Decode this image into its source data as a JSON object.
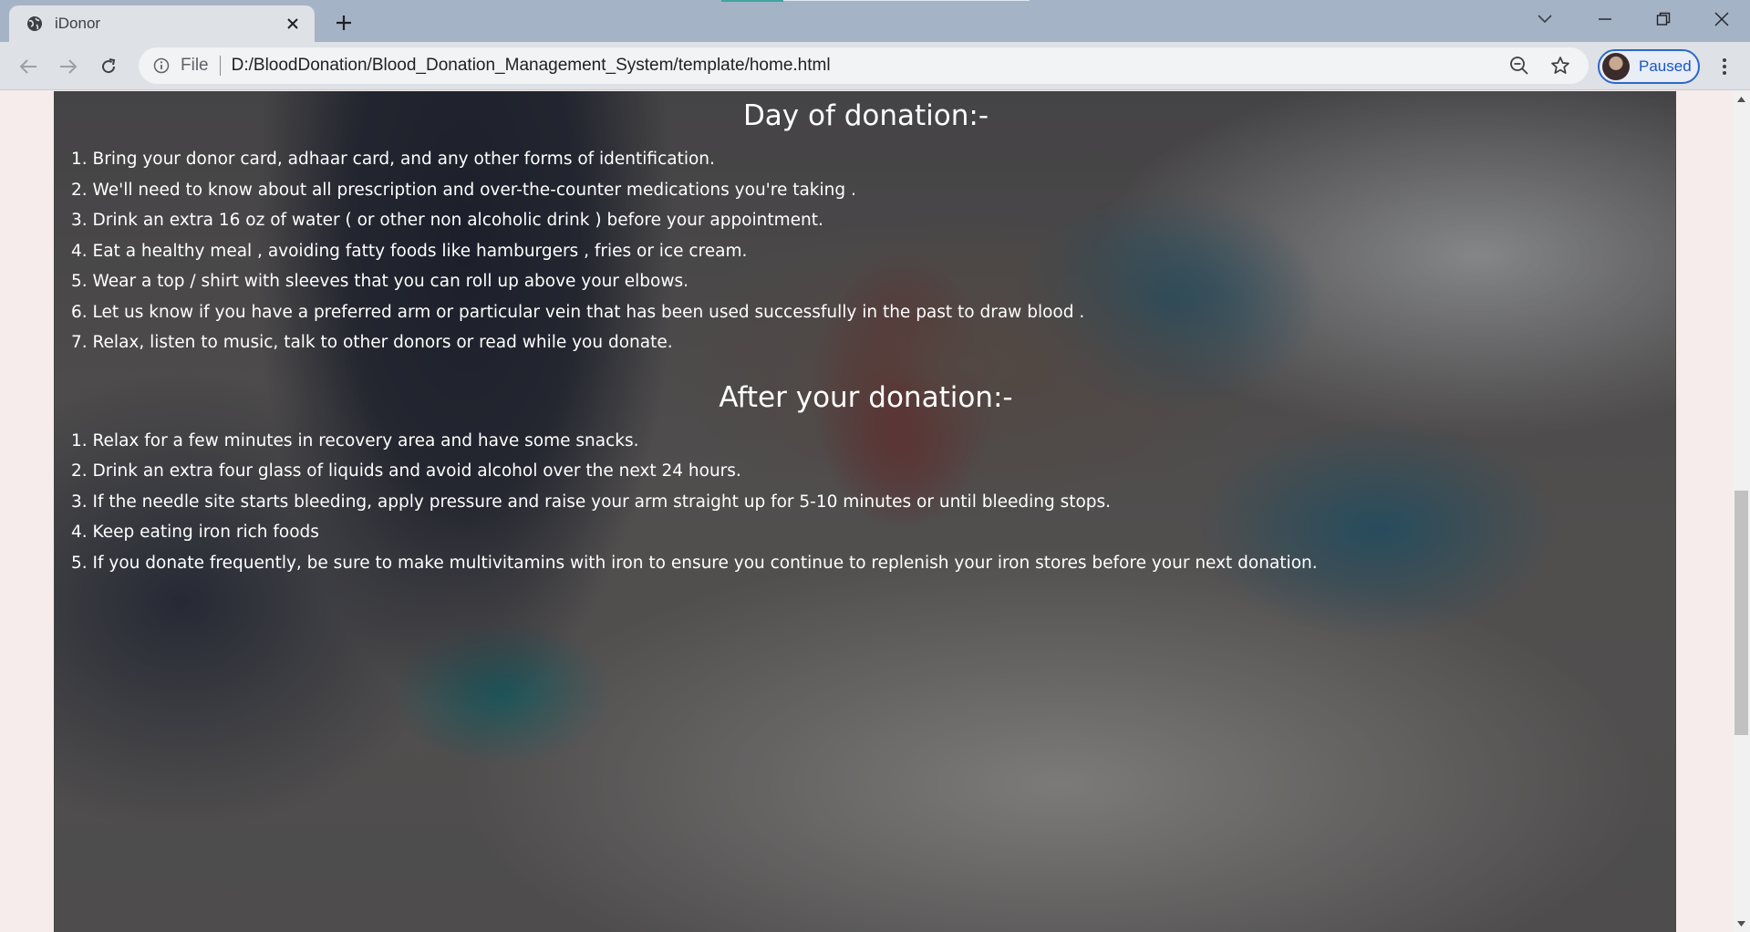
{
  "browser": {
    "tab_title": "iDonor",
    "omnibox_scheme_label": "File",
    "url": "D:/BloodDonation/Blood_Donation_Management_System/template/home.html",
    "profile_label": "Paused"
  },
  "page": {
    "day_of_donation": {
      "heading": "Day of donation:-",
      "items": [
        "1. Bring your donor card, adhaar card, and any other forms of identification.",
        "2. We'll need to know about all prescription and over-the-counter medications you're taking .",
        "3. Drink an extra 16 oz of water ( or other non alcoholic drink ) before your appointment.",
        "4. Eat a healthy meal , avoiding fatty foods like hamburgers , fries or ice cream.",
        "5. Wear a top / shirt with sleeves that you can roll up above your elbows.",
        "6. Let us know if you have a preferred arm or particular vein that has been used successfully in the past to draw blood .",
        "7. Relax, listen to music, talk to other donors or read while you donate."
      ]
    },
    "after_donation": {
      "heading": "After your donation:-",
      "items": [
        "1. Relax for a few minutes in recovery area and have some snacks.",
        "2. Drink an extra four glass of liquids and avoid alcohol over the next 24 hours.",
        "3. If the needle site starts bleeding, apply pressure and raise your arm straight up for 5-10 minutes or until bleeding stops.",
        "4. Keep eating iron rich foods",
        "5. If you donate frequently, be sure to make multivitamins with iron to ensure you continue to replenish your iron stores before your next donation."
      ]
    }
  },
  "icons": {
    "tab_favicon": "globe-icon",
    "tab_close": "close-icon",
    "new_tab": "plus-icon",
    "tab_search": "chevron-down-icon",
    "minimize": "minimize-icon",
    "restore": "restore-icon",
    "close_window": "close-icon",
    "back": "back-arrow-icon",
    "forward": "forward-arrow-icon",
    "reload": "reload-icon",
    "site_info": "info-icon",
    "zoom": "zoom-icon",
    "bookmark": "star-icon",
    "menu": "kebab-menu-icon"
  },
  "colors": {
    "titlebar": "#a5b3c6",
    "toolbar": "#dee1e6",
    "profile_accent": "#2d67c9",
    "page_background": "#f6eceb",
    "text": "#ffffff"
  }
}
